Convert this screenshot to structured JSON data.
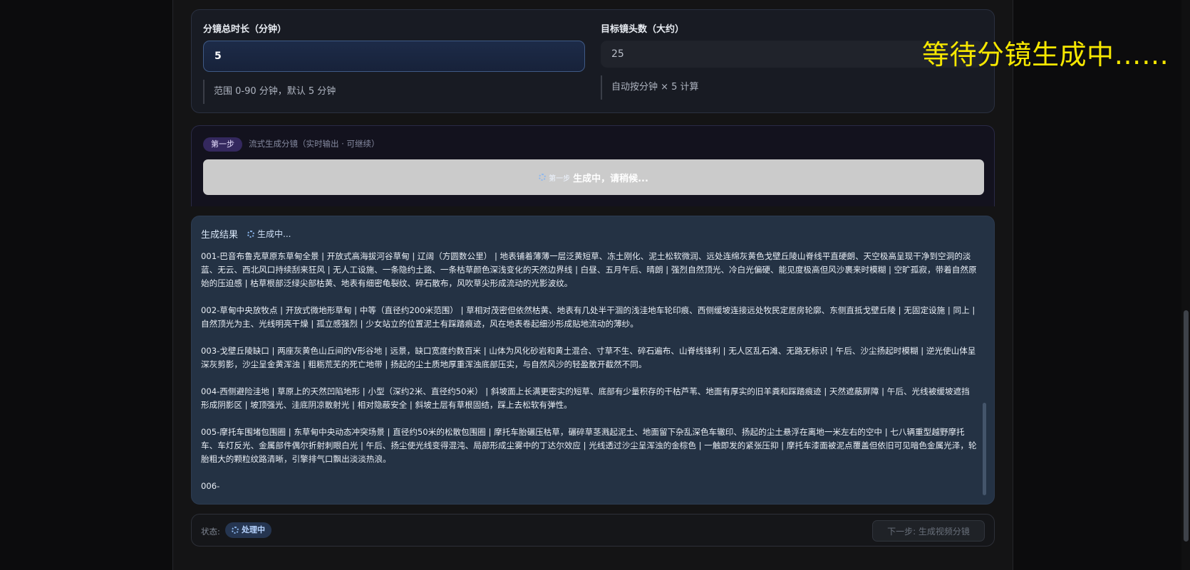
{
  "settings": {
    "duration_label": "分镜总时长（分钟）",
    "duration_value": "5",
    "duration_hint": "范围 0-90 分钟，默认 5 分钟",
    "target_label": "目标镜头数（大约）",
    "target_value": "25",
    "target_hint": "自动按分钟 × 5 计算"
  },
  "overlay_status": "等待分镜生成中……",
  "step": {
    "badge": "第一步",
    "description": "流式生成分镜（实时输出 · 可继续）",
    "button_prefix": "第一步",
    "button_label": "生成中，请稍候..."
  },
  "result": {
    "title": "生成结果",
    "status": "生成中...",
    "entries": [
      "001-巴音布鲁克草原东草甸全景 | 开放式高海拔河谷草甸 | 辽阔（方圆数公里） | 地表铺着薄薄一层泛黄短草、冻土刚化、泥土松软微润、远处连绵灰黄色戈壁丘陵山脊线平直硬朗、天空极高呈现干净到空洞的淡蓝、无云、西北风口持续刮来狂风 | 无人工设施、一条隐约土路、一条枯草颜色深浅变化的天然边界线 | 白昼、五月午后、晴朗 | 强烈自然顶光、冷白光偏硬、能见度极高但风沙裹来时模糊 | 空旷孤寂，带着自然原始的压迫感 | 枯草根部泛绿尖部枯黄、地表有细密龟裂纹、碎石散布，风吹草尖形成流动的光影波纹。",
      "002-草甸中央放牧点 | 开放式微地形草甸 | 中等（直径约200米范围） | 草相对茂密但依然枯黄、地表有几处半干涸的浅洼地车轮印痕、西侧缓坡连接远处牧民定居房轮廓、东侧直抵戈壁丘陵 | 无固定设施 | 同上 | 自然顶光为主、光线明亮干燥 | 孤立感强烈 | 少女站立的位置泥土有踩踏痕迹，风在地表卷起细沙形成贴地流动的薄纱。",
      "003-戈壁丘陵缺口 | 两座灰黄色山丘间的V形谷地 | 远景，缺口宽度约数百米 | 山体为风化砂岩和黄土混合、寸草不生、碎石遍布、山脊线锋利 | 无人区乱石滩、无路无标识 | 午后、沙尘扬起时模糊 | 逆光使山体呈深灰剪影，沙尘呈金黄浑浊 | 粗粝荒芜的死亡地带 | 扬起的尘土质地厚重浑浊底部压实，与自然风沙的轻盈散开截然不同。",
      "004-西侧避险洼地 | 草原上的天然凹陷地形 | 小型（深约2米、直径约50米） | 斜坡面上长满更密实的短草、底部有少量积存的干枯芦苇、地面有厚实的旧羊粪和踩踏痕迹 | 天然遮蔽屏障 | 午后、光线被缓坡遮挡形成阴影区 | 坡顶强光、洼底阴凉散射光 | 相对隐蔽安全 | 斜坡土层有草根固结，踩上去松软有弹性。",
      "005-摩托车围堵包围圈 | 东草甸中央动态冲突场景 | 直径约50米的松散包围圈 | 摩托车胎碾压枯草，碾碎草茎溅起泥土、地面留下杂乱深色车辙印、扬起的尘土悬浮在离地一米左右的空中 | 七八辆重型越野摩托车、车灯反光、金属部件偶尔折射刺眼白光 | 午后、扬尘使光线变得混沌、局部形成尘雾中的丁达尔效应 | 光线透过沙尘呈浑浊的金棕色 | 一触即发的紧张压抑 | 摩托车漆面被泥点覆盖但依旧可见暗色金属光泽，轮胎粗大的颗粒纹路清晰，引擎排气口飘出淡淡热浪。",
      "006-"
    ]
  },
  "footer": {
    "status_label": "状态:",
    "status_value": "处理中",
    "next_button": "下一步: 生成视频分镜"
  }
}
